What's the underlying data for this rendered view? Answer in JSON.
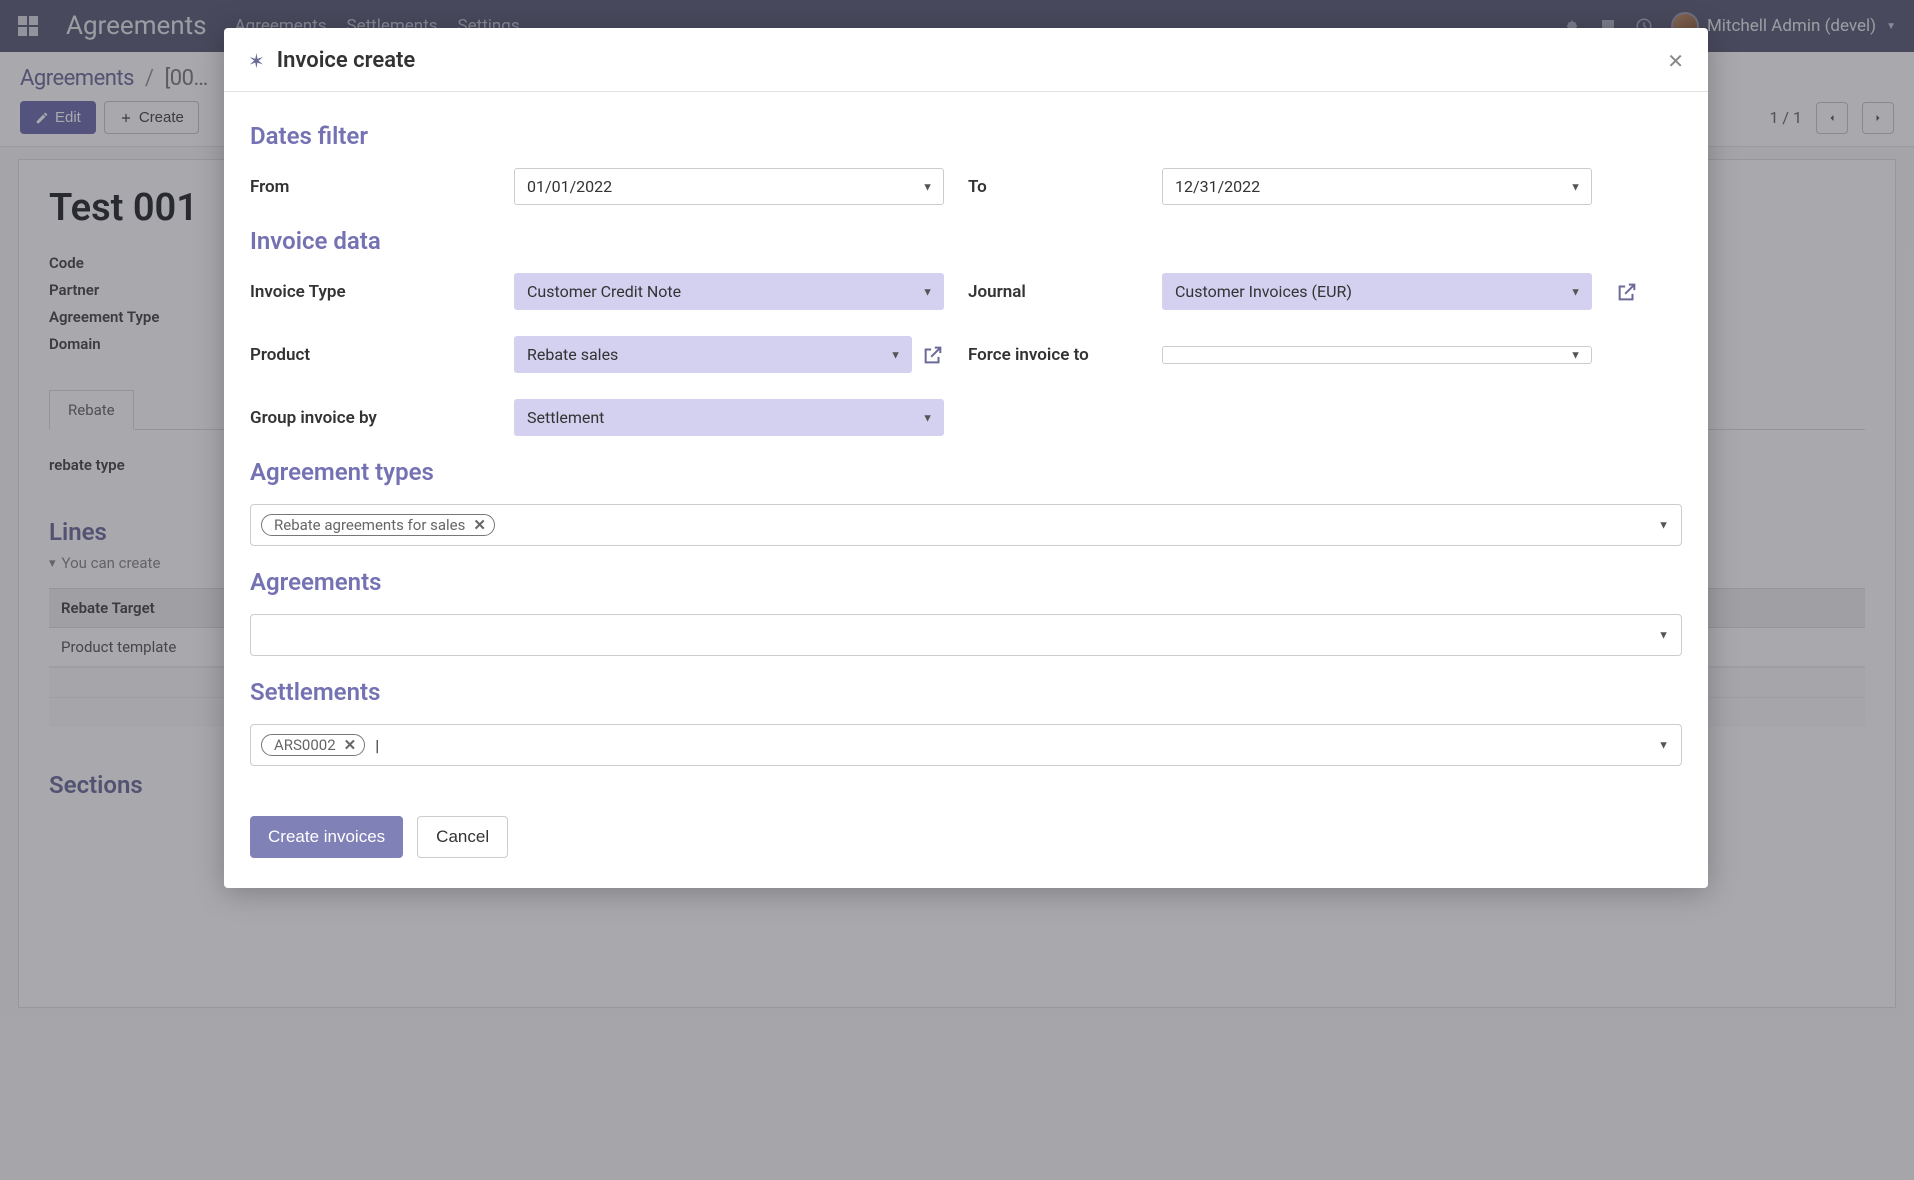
{
  "topbar": {
    "brand": "Agreements",
    "menu": [
      "Agreements",
      "Settlements",
      "Settings"
    ],
    "user": "Mitchell Admin (devel)"
  },
  "breadcrumb": {
    "parent": "Agreements",
    "current": "[00…"
  },
  "controls": {
    "edit": "Edit",
    "create": "Create",
    "pager": "1 / 1"
  },
  "form": {
    "title": "Test 001",
    "labels": {
      "code": "Code",
      "partner": "Partner",
      "agreement_type": "Agreement Type",
      "domain": "Domain"
    },
    "tab": "Rebate",
    "rebate_type_label": "rebate type",
    "lines_heading": "Lines",
    "lines_hint": "You can create",
    "rebate_target_th": "Rebate Target",
    "rebate_target_td": "Product template",
    "sections_heading": "Sections"
  },
  "modal": {
    "title": "Invoice create",
    "dates_filter_heading": "Dates filter",
    "from_label": "From",
    "from_value": "01/01/2022",
    "to_label": "To",
    "to_value": "12/31/2022",
    "invoice_data_heading": "Invoice data",
    "invoice_type_label": "Invoice Type",
    "invoice_type_value": "Customer Credit Note",
    "journal_label": "Journal",
    "journal_value": "Customer Invoices (EUR)",
    "product_label": "Product",
    "product_value": "Rebate sales",
    "force_invoice_label": "Force invoice to",
    "force_invoice_value": "",
    "group_by_label": "Group invoice by",
    "group_by_value": "Settlement",
    "agreement_types_heading": "Agreement types",
    "agreement_types_tag": "Rebate agreements for sales",
    "agreements_heading": "Agreements",
    "settlements_heading": "Settlements",
    "settlements_tag": "ARS0002",
    "create_invoices_btn": "Create invoices",
    "cancel_btn": "Cancel"
  }
}
